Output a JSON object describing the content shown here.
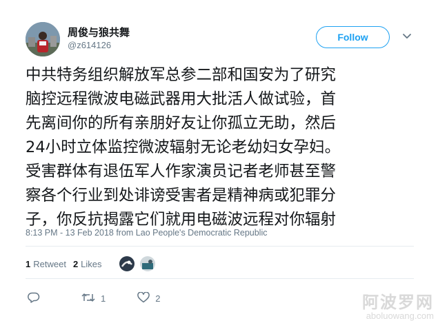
{
  "user": {
    "display_name": "周俊与狼共舞",
    "username": "@z614126"
  },
  "follow_label": "Follow",
  "tweet": {
    "text": "中共特务组织解放军总参二部和国安为了研究\n脑控远程微波电磁武器用大批活人做试验，首\n先离间你的所有亲朋好友让你孤立无助，然后\n24小时立体监控微波辐射无论老幼妇女孕妇。\n受害群体有退伍军人作家演员记者老师甚至警\n察各个行业到处诽谤受害者是精神病或犯罪分\n子，你反抗揭露它们就用电磁波远程对你辐射",
    "timestamp": "8:13 PM - 13 Feb 2018 from Lao People's Democratic Republic"
  },
  "stats": {
    "retweets_count": "1",
    "retweets_label": "Retweet",
    "likes_count": "2",
    "likes_label": "Likes"
  },
  "actions": {
    "reply_icon": "reply-icon",
    "retweet_icon": "retweet-icon",
    "retweet_count": "1",
    "like_icon": "heart-icon",
    "like_count": "2"
  },
  "watermark": {
    "title": "阿波罗网",
    "url": "aboluowang.com"
  },
  "colors": {
    "accent": "#1da1f2",
    "text": "#14171a",
    "muted": "#657786",
    "divider": "#e6ecf0"
  }
}
